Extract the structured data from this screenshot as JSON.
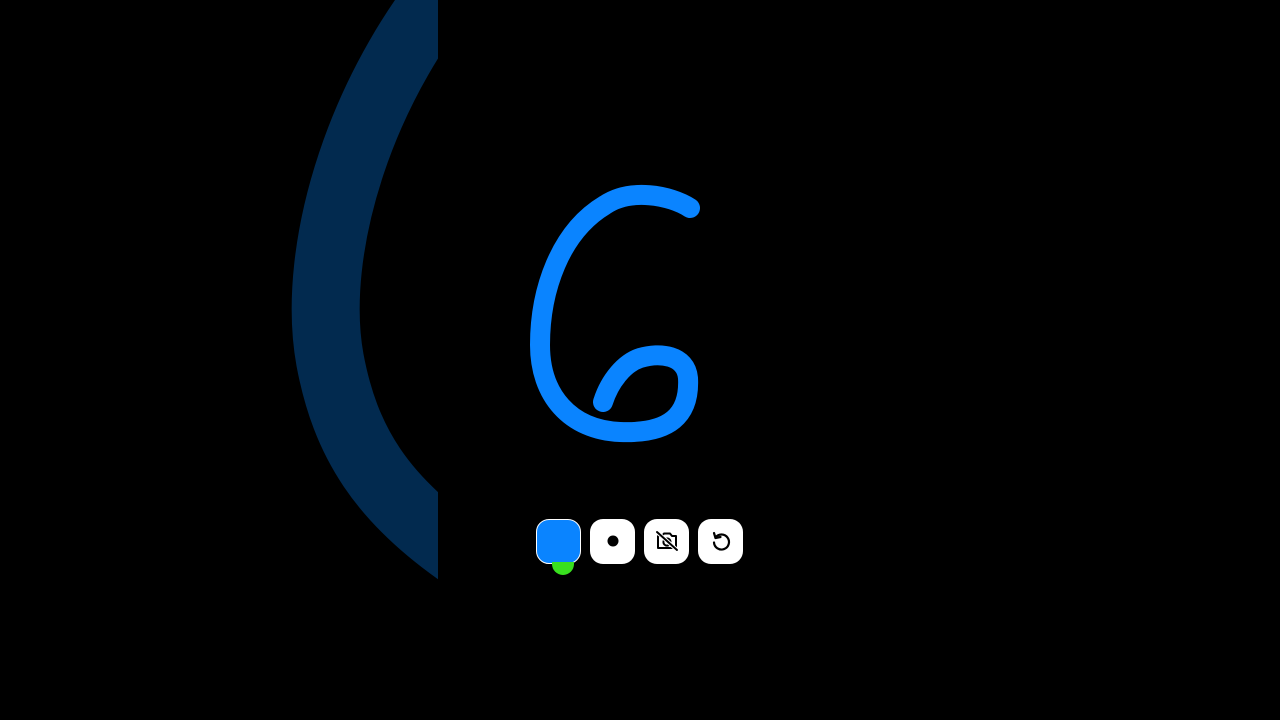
{
  "canvas": {
    "background_color": "#000000",
    "background_stroke_color": "#022a4f",
    "stroke_color": "#0a84ff"
  },
  "toolbar": {
    "color_swatch": {
      "color": "#0a84ff",
      "icon": "color-swatch"
    },
    "brush_size": {
      "icon": "dot-icon"
    },
    "camera_toggle": {
      "icon": "camera-off-icon"
    },
    "reset": {
      "icon": "rotate-ccw-icon"
    }
  },
  "cursor": {
    "color": "#39e01f"
  }
}
